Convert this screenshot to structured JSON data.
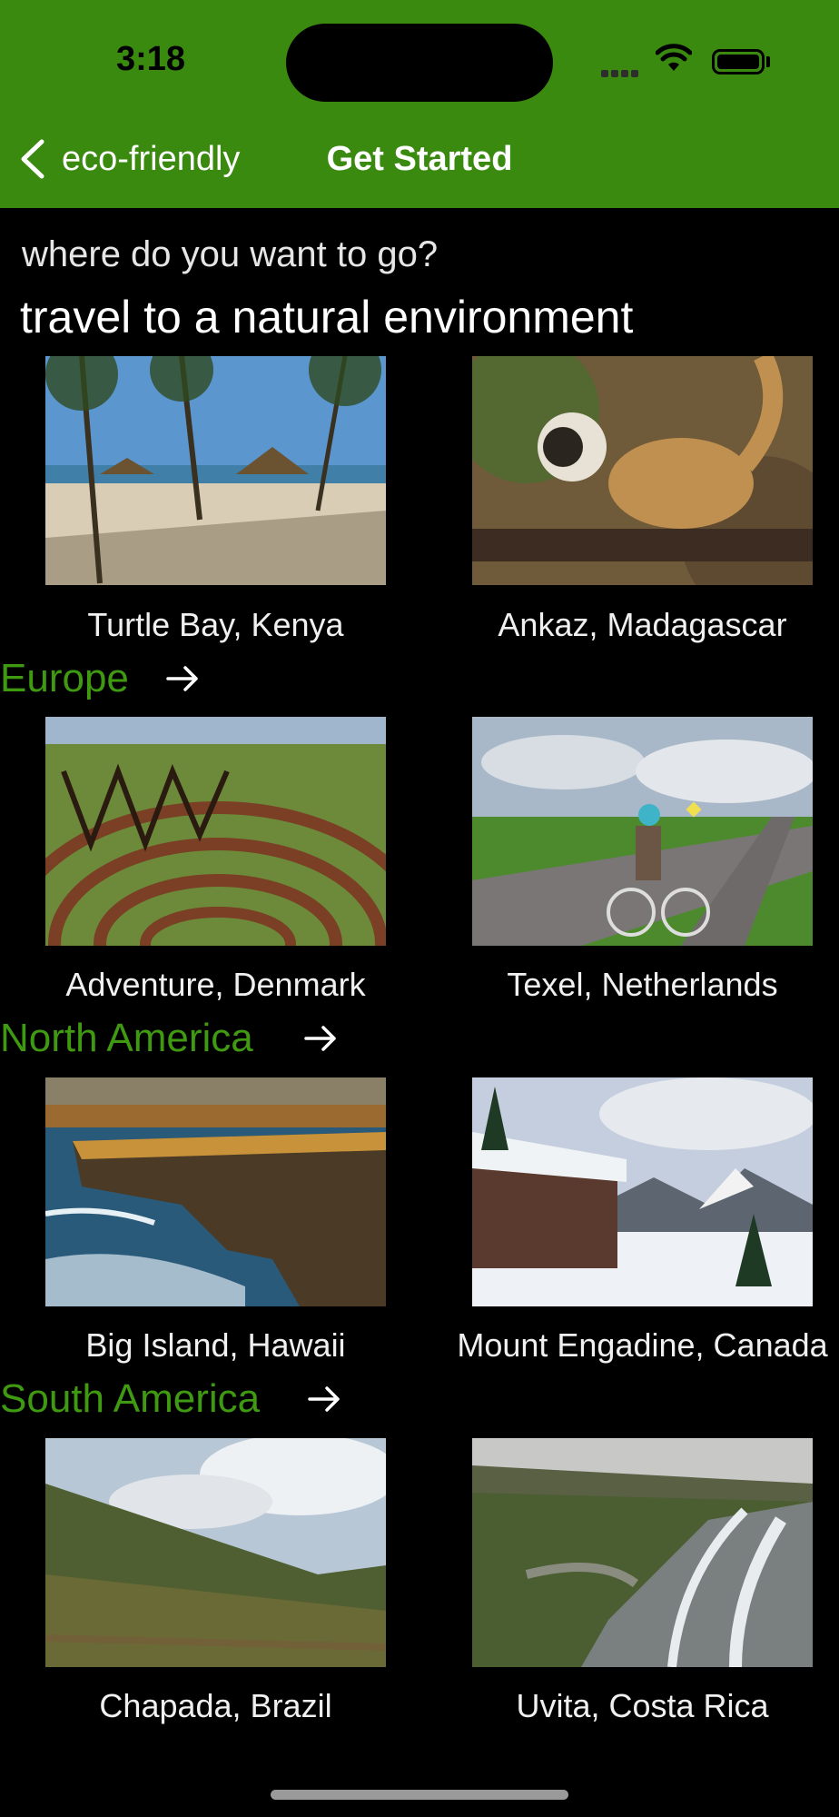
{
  "status_bar": {
    "time": "3:18"
  },
  "nav": {
    "back_label": "eco-friendly",
    "title": "Get Started"
  },
  "prompt": "where do you want to go?",
  "section_title": "travel to a natural environment",
  "featured": [
    {
      "caption": "Turtle Bay, Kenya"
    },
    {
      "caption": "Ankaz, Madagascar"
    }
  ],
  "regions": [
    {
      "name": "Europe",
      "places": [
        {
          "caption": "Adventure, Denmark"
        },
        {
          "caption": "Texel, Netherlands"
        }
      ]
    },
    {
      "name": "North America",
      "places": [
        {
          "caption": "Big Island, Hawaii"
        },
        {
          "caption": "Mount Engadine, Canada"
        }
      ]
    },
    {
      "name": "South America",
      "places": [
        {
          "caption": "Chapada, Brazil"
        },
        {
          "caption": "Uvita, Costa Rica"
        }
      ]
    }
  ],
  "colors": {
    "header": "#3a8a10",
    "region_link": "#3f9a12",
    "background": "#000000"
  },
  "icons": [
    "signal-icon",
    "wifi-icon",
    "battery-icon",
    "chevron-left-icon",
    "arrow-right-icon"
  ]
}
